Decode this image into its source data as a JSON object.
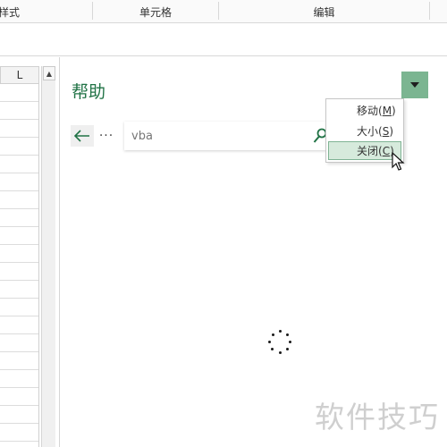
{
  "ribbon": {
    "groups": [
      "样式",
      "单元格",
      "编辑"
    ]
  },
  "sheet": {
    "column_header": "L",
    "scroll_up_glyph": "▲"
  },
  "help_pane": {
    "title": "帮助",
    "back_glyph": "←",
    "more_glyph": "···",
    "search_value": "vba",
    "search_icon": "search-icon",
    "dropdown_icon": "chevron-down-icon",
    "accent_color": "#217346",
    "dropdown_color": "#7bb591",
    "status": "loading"
  },
  "context_menu": {
    "items": [
      {
        "text": "移动(",
        "key": "M",
        "close": ")"
      },
      {
        "text": "大小(",
        "key": "S",
        "close": ")"
      },
      {
        "text": "关闭(",
        "key": "C",
        "close": ")"
      }
    ],
    "highlighted_index": 2,
    "highlight_color": "#d6eadc"
  },
  "watermark": {
    "text": "软件技巧"
  }
}
